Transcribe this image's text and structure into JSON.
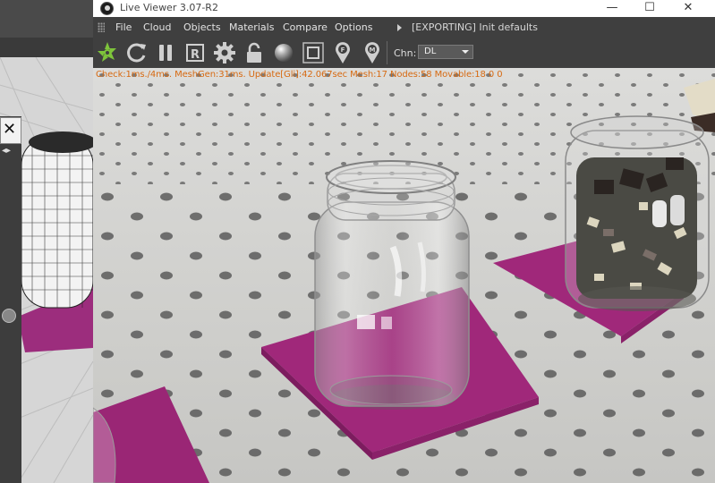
{
  "window": {
    "title": "Live Viewer 3.07-R2",
    "minimize_glyph": "—",
    "maximize_glyph": "☐",
    "close_glyph": "✕"
  },
  "menu": {
    "items": [
      "File",
      "Cloud",
      "Objects",
      "Materials",
      "Compare",
      "Options"
    ],
    "status": "[EXPORTING] Init defaults"
  },
  "toolbar": {
    "icons": [
      "render-start-icon",
      "refresh-icon",
      "pause-icon",
      "region-render-icon",
      "settings-gear-icon",
      "lock-icon",
      "material-ball-icon",
      "focus-frame-icon",
      "focus-pick-icon",
      "material-pick-icon"
    ],
    "channel_label": "Chn:",
    "channel_value": "DL"
  },
  "render": {
    "stats": "Check:1ms./4ms. MeshGen:31ms. Update[Gli]:42.067sec Mesh:17 Nodes:58 Movable:18  0 0"
  },
  "background_app": {
    "popup_glyph": "✕"
  },
  "colors": {
    "stats_text": "#d76a12",
    "render_start_icon": "#7ec43b",
    "coaster": "#a0287a",
    "floor": "#d2d2cf"
  }
}
